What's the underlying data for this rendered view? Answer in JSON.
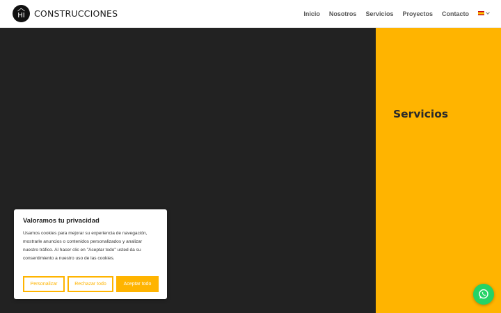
{
  "header": {
    "logo_text": "CONSTRUCCIONES",
    "logo_mark_text": "HI",
    "nav": [
      {
        "label": "Inicio"
      },
      {
        "label": "Nosotros"
      },
      {
        "label": "Servicios"
      },
      {
        "label": "Proyectos"
      },
      {
        "label": "Contacto"
      }
    ],
    "language_icon": "spain-flag-icon"
  },
  "main": {
    "services_title": "Servicios",
    "colors": {
      "dark": "#222222",
      "accent": "#ffb400"
    }
  },
  "cookie_banner": {
    "title": "Valoramos tu privacidad",
    "text": "Usamos cookies para mejorar su experiencia de navegación, mostrarle anuncios o contenidos personalizados y analizar nuestro tráfico. Al hacer clic en \"Aceptar todo\" usted da su consentimiento a nuestro uso de las cookies.",
    "buttons": {
      "customize": "Personalizar",
      "reject": "Rechazar todo",
      "accept": "Aceptar todo"
    }
  },
  "whatsapp": {
    "icon": "whatsapp-icon",
    "color": "#25d366"
  }
}
